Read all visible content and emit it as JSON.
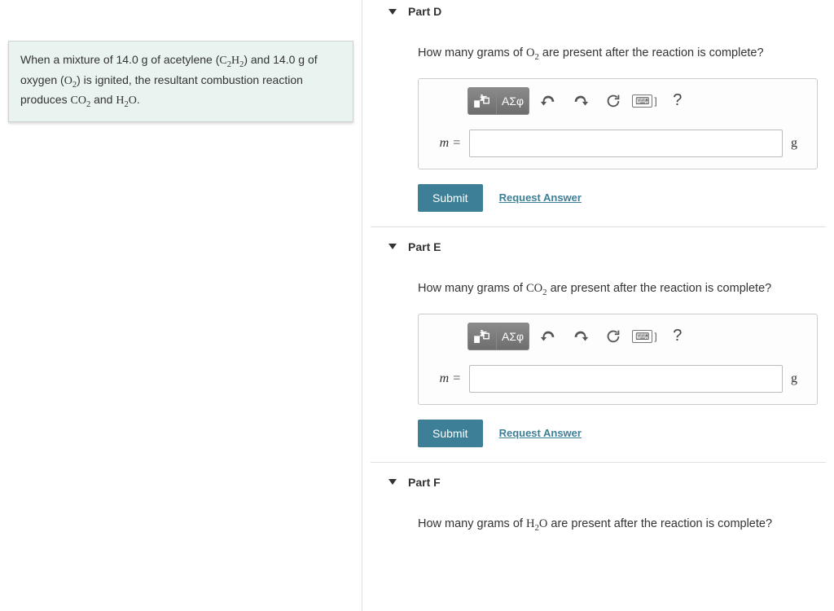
{
  "problem": {
    "text_parts": [
      "When a mixture of 14.0 g of acetylene (",
      ") and 14.0 g of oxygen (",
      ") is ignited, the resultant combustion reaction produces ",
      " and ",
      "."
    ],
    "formulas": [
      "C₂H₂",
      "O₂",
      "CO₂",
      "H₂O"
    ]
  },
  "parts": {
    "D": {
      "title": "Part D",
      "question_prefix": "How many grams of ",
      "question_formula": "O₂",
      "question_suffix": " are present after the reaction is complete?",
      "var_label": "m =",
      "unit": "g",
      "submit": "Submit",
      "request": "Request Answer"
    },
    "E": {
      "title": "Part E",
      "question_prefix": "How many grams of ",
      "question_formula": "CO₂",
      "question_suffix": " are present after the reaction is complete?",
      "var_label": "m =",
      "unit": "g",
      "submit": "Submit",
      "request": "Request Answer"
    },
    "F": {
      "title": "Part F",
      "question_prefix": "How many grams of ",
      "question_formula": "H₂O",
      "question_suffix": " are present after the reaction is complete?"
    }
  },
  "toolbar": {
    "greek": "ΑΣφ"
  }
}
